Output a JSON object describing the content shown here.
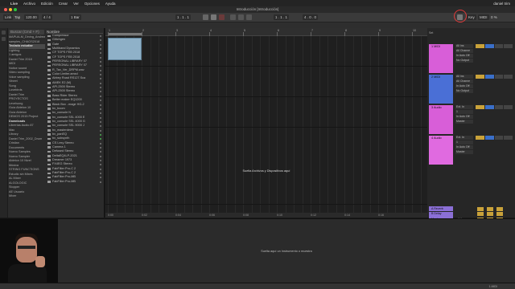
{
  "menubar": {
    "app_name": "Live",
    "items": [
      "Archivo",
      "Edición",
      "Crear",
      "Ver",
      "Opciones",
      "Ayuda"
    ],
    "right_label": "daniel trim"
  },
  "window": {
    "title": "Introducción  [Introducción]"
  },
  "transport": {
    "link_label": "Link",
    "tempo": "120.00",
    "time_sig": "4 / 4",
    "quantize": "1 Bar",
    "position": "1 . 1 . 1",
    "loop_start": "1 . 1 . 1",
    "loop_length": "4 . 0 . 0",
    "key_label": "Key",
    "midi_label": "MIDI",
    "cpu": "0 %"
  },
  "browser": {
    "search_placeholder": "Buscar (Cmd + F)",
    "sidebar_items": [
      "MAPUA-M_Dining_Andrew",
      "samples_CHAOS2018",
      "Teclado estudiar",
      "Lighting",
      "1 amigos",
      "Daniel Trim 2018",
      "MIDI",
      "Notice sound",
      "Video sampling",
      "Voice sampling",
      "Vineet",
      "Song",
      "Lovebirds",
      "Daniel Trim",
      "PROYECTOS",
      "Levelsong",
      "Guía Ableton 10",
      "Guía Ableton",
      "DEMOS 2015 Project",
      "Downloads",
      "Librerías Audio 87",
      "Mac",
      "Library",
      "Daniel Trim_2002_Drum",
      "Cristian",
      "Documents",
      "Nuevo Samples",
      "Nuevo Sampler",
      "Ableton 10 Nivel",
      "Música",
      "STRING FUNCTIONS",
      "Estudio sin Mixes",
      "AL Mixer",
      "ALGOLOGIC",
      "Stopper",
      "AE Usuario",
      "Mixer"
    ],
    "column_header": "Nombre",
    "files": [
      "Compressor",
      "Glitchgen",
      "Gate",
      "Multiband Dynamics",
      "CF TOPS FEB 2018",
      "CF TOPS FEB 2018",
      "PERSONAL LIBRARY 07",
      "PERSONAL LIBRARY 07",
      "R_Tax_Ver_DRPM.wav",
      "Color Limiter.amxd",
      "Abbey Road RS127.Sca",
      "AMEK E2 (M)",
      "API-2500 Stereo",
      "API-2500 Stereo",
      "Bass Rider Stereo",
      "Better maker EQ1200",
      "Black Box ..mage HG-2",
      "bx_boom",
      "bx_console N",
      "bx_console SSL 4000 E",
      "bx_console SSL 4000 G",
      "bx_console SSL 9000 J",
      "bx_masterdesk",
      "bx_panEQ",
      "bx_subsynth",
      "CS Lexy Stereo",
      "Camera 1",
      "Defused Stereo",
      "DeltaEQ4LP-2021",
      "Dreamer 1973",
      "FX4EG Stereo",
      "FabFilter Pro-C 2",
      "FabFilter Pro-C 2",
      "FabFilter Pro-MB",
      "FabFilter Pro-MB"
    ]
  },
  "arrangement": {
    "bar_numbers": [
      "1",
      "2",
      "3",
      "4",
      "5",
      "6",
      "7",
      "8",
      "9",
      "10",
      "11"
    ],
    "drop_hint": "Suelta Archivos y Dispositivos aquí",
    "time_markers": [
      "0:00",
      "0:02",
      "0:04",
      "0:06",
      "0:08",
      "0:10",
      "0:12",
      "0:14",
      "0:16"
    ],
    "set_label": "Set"
  },
  "tracks": [
    {
      "name": "1 MIDI",
      "color": "#d85ed8",
      "io": [
        "All Ins",
        "All Channe",
        "In Auto Off",
        "No Output"
      ]
    },
    {
      "name": "2 MIDI",
      "color": "#4a6fd6",
      "io": [
        "All Ins",
        "All Channe",
        "In Auto Off",
        "No Output"
      ]
    },
    {
      "name": "3 Audio",
      "color": "#d85ed8",
      "io": [
        "Ext. In",
        "1",
        "In Auto Off",
        "Master"
      ]
    },
    {
      "name": "4 Audio",
      "color": "#e06ae0",
      "io": [
        "Ext. In",
        "1",
        "In Auto Off",
        "Master"
      ]
    }
  ],
  "returns": [
    {
      "name": "A Reverb",
      "color": "#8b6fd6"
    },
    {
      "name": "B Delay",
      "color": "#8b6fd6"
    },
    {
      "name": "Master",
      "color": "#8b6fd6",
      "value": "1/4"
    }
  ],
  "detail": {
    "drop_hint": "Suelta aquí un Instrumento o muestra"
  },
  "status": {
    "right_text": "1-MIDI"
  }
}
